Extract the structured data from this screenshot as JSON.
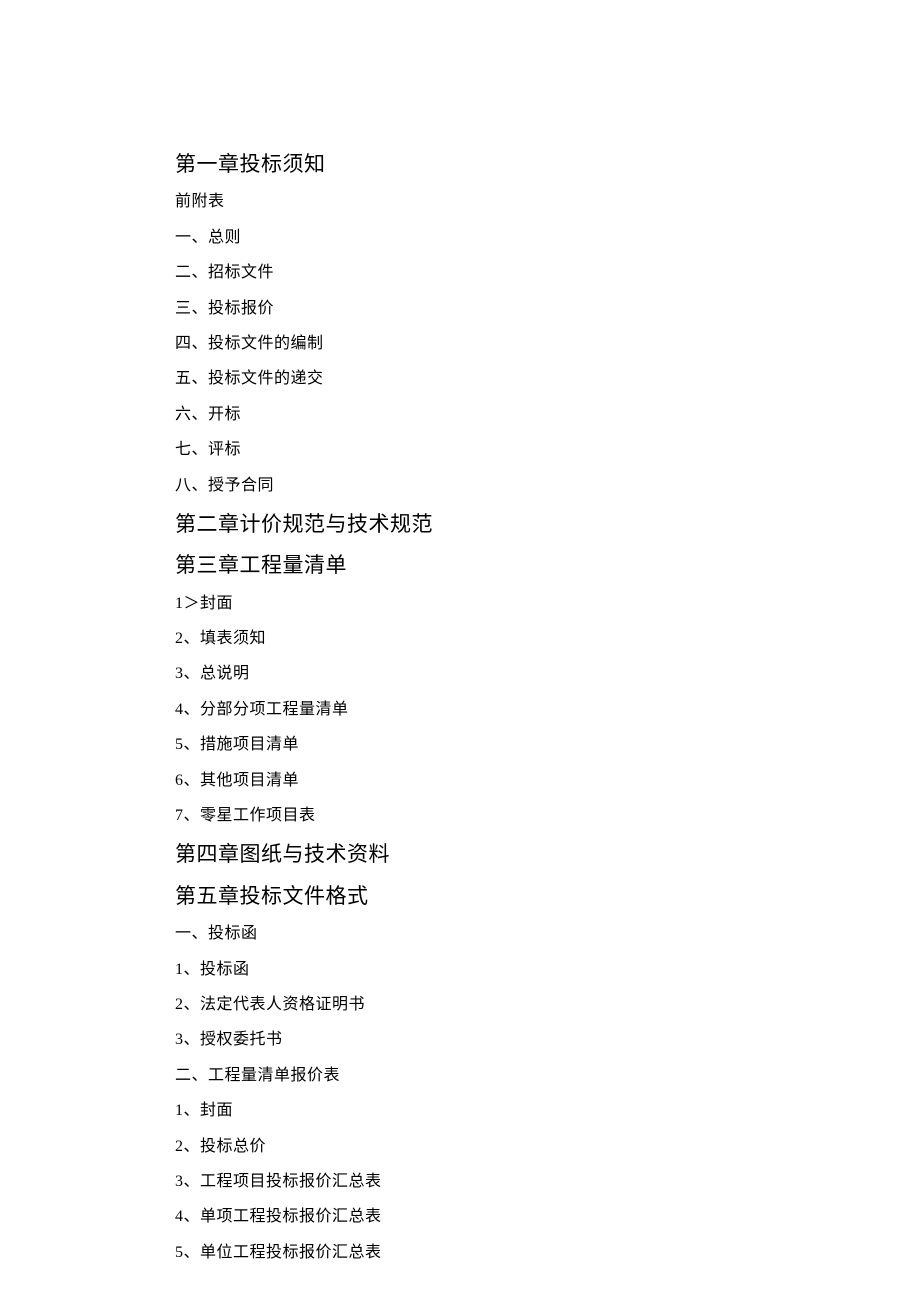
{
  "entries": [
    {
      "text": "第一章投标须知",
      "level": "chapter"
    },
    {
      "text": "前附表",
      "level": "item"
    },
    {
      "text": "一、总则",
      "level": "item"
    },
    {
      "text": "二、招标文件",
      "level": "item"
    },
    {
      "text": "三、投标报价",
      "level": "item"
    },
    {
      "text": "四、投标文件的编制",
      "level": "item"
    },
    {
      "text": "五、投标文件的递交",
      "level": "item"
    },
    {
      "text": "六、开标",
      "level": "item"
    },
    {
      "text": "七、评标",
      "level": "item"
    },
    {
      "text": "八、授予合同",
      "level": "item"
    },
    {
      "text": "第二章计价规范与技术规范",
      "level": "chapter"
    },
    {
      "text": "第三章工程量清单",
      "level": "chapter"
    },
    {
      "text": "1＞封面",
      "level": "item"
    },
    {
      "text": "2、填表须知",
      "level": "item"
    },
    {
      "text": "3、总说明",
      "level": "item"
    },
    {
      "text": "4、分部分项工程量清单",
      "level": "item"
    },
    {
      "text": "5、措施项目清单",
      "level": "item"
    },
    {
      "text": "6、其他项目清单",
      "level": "item"
    },
    {
      "text": "7、零星工作项目表",
      "level": "item"
    },
    {
      "text": "第四章图纸与技术资料",
      "level": "chapter"
    },
    {
      "text": "第五章投标文件格式",
      "level": "chapter"
    },
    {
      "text": "一、投标函",
      "level": "item"
    },
    {
      "text": "1、投标函",
      "level": "item"
    },
    {
      "text": "2、法定代表人资格证明书",
      "level": "item"
    },
    {
      "text": "3、授权委托书",
      "level": "item"
    },
    {
      "text": "二、工程量清单报价表",
      "level": "item"
    },
    {
      "text": "1、封面",
      "level": "item"
    },
    {
      "text": "2、投标总价",
      "level": "item"
    },
    {
      "text": "3、工程项目投标报价汇总表",
      "level": "item"
    },
    {
      "text": "4、单项工程投标报价汇总表",
      "level": "item"
    },
    {
      "text": "5、单位工程投标报价汇总表",
      "level": "item"
    }
  ]
}
